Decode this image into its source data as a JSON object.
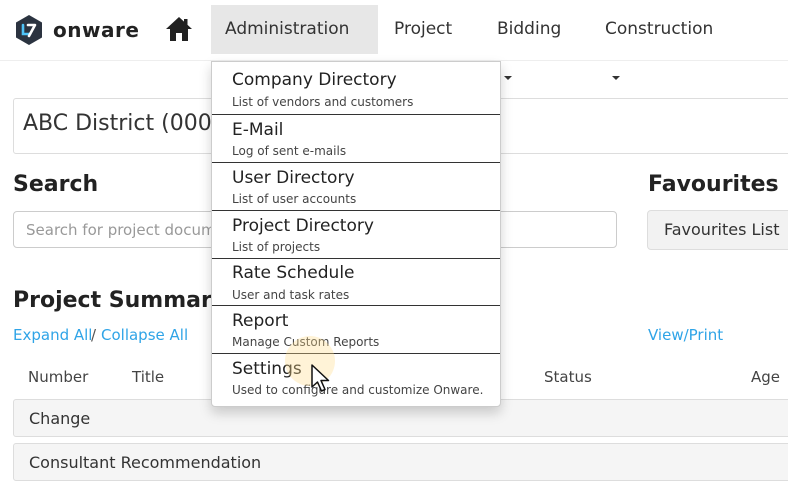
{
  "brand": {
    "name": "onware"
  },
  "nav": {
    "items": [
      {
        "label": "Administration"
      },
      {
        "label": "Project"
      },
      {
        "label": "Bidding"
      },
      {
        "label": "Construction"
      }
    ]
  },
  "page": {
    "district_title": "ABC District (0000",
    "search_heading": "Search",
    "search_placeholder": "Search for project documents",
    "favourites_heading": "Favourites",
    "favourites_button": "Favourites List",
    "summary_heading": "Project Summary",
    "expand_all": "Expand All",
    "separator": "/",
    "collapse_all": "Collapse All",
    "view_print": "View/Print",
    "columns": [
      "Number",
      "Title",
      "Status",
      "Age"
    ],
    "groups": [
      "Change",
      "Consultant Recommendation"
    ]
  },
  "dropdown": {
    "items": [
      {
        "title": "Company Directory",
        "subtitle": "List of vendors and customers"
      },
      {
        "title": "E-Mail",
        "subtitle": "Log of sent e-mails"
      },
      {
        "title": "User Directory",
        "subtitle": "List of user accounts"
      },
      {
        "title": "Project Directory",
        "subtitle": "List of projects"
      },
      {
        "title": "Rate Schedule",
        "subtitle": "User and task rates"
      },
      {
        "title": "Report",
        "subtitle": "Manage Custom Reports"
      },
      {
        "title": "Settings",
        "subtitle": "Used to configure and customize Onware."
      }
    ]
  },
  "colors": {
    "link": "#2fa4e7",
    "logo_bg": "#2b3340",
    "active_nav_bg": "#e7e7e7"
  }
}
